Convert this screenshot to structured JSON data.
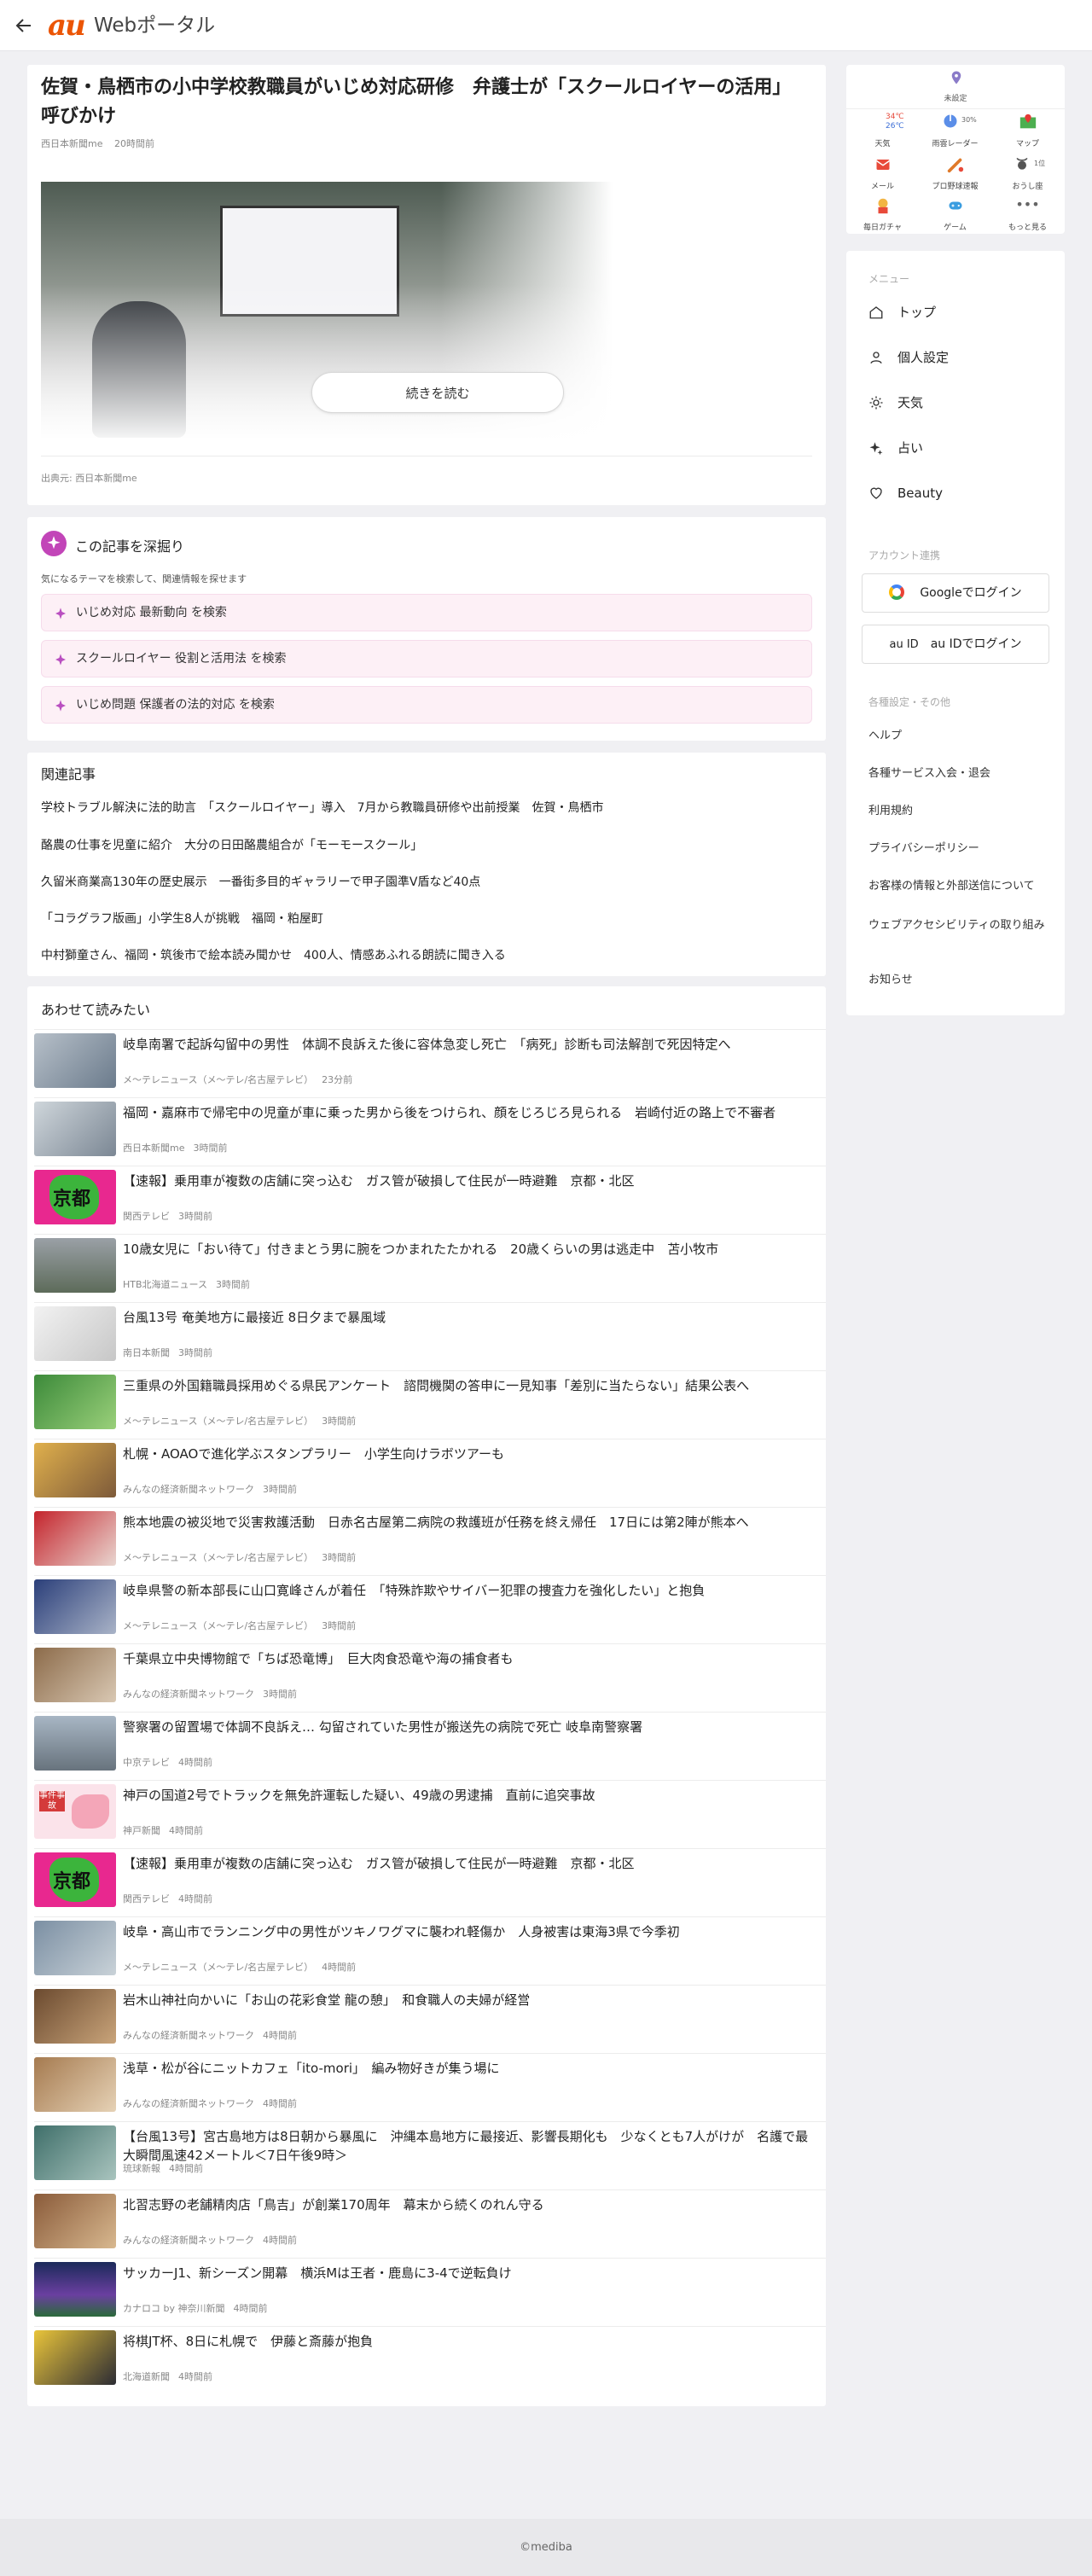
{
  "header": {
    "logo": "au",
    "brand": "Webポータル",
    "icons": {
      "back": "back-arrow-icon"
    }
  },
  "article": {
    "title": "佐賀・鳥栖市の小中学校教職員がいじめ対応研修　弁護士が「スクールロイヤーの活用」呼びかけ",
    "source": "西日本新聞me",
    "time": "20時間前",
    "continue_label": "続きを読む",
    "credit": "出典元: 西日本新聞me"
  },
  "deep_dive": {
    "title": "この記事を深掘り",
    "hint": "気になるテーマを検索して、関連情報を探せます",
    "queries": [
      "いじめ対応 最新動向 を検索",
      "スクールロイヤー 役割と活用法 を検索",
      "いじめ問題 保護者の法的対応 を検索"
    ]
  },
  "related": {
    "title": "関連記事",
    "items": [
      "学校トラブル解決に法的助言　「スクールロイヤー」導入　7月から教職員研修や出前授業　佐賀・鳥栖市",
      "酪農の仕事を児童に紹介　大分の日田酪農組合が「モーモースクール」",
      "久留米商業高130年の歴史展示　一番街多目的ギャラリーで甲子園準V盾など40点",
      "「コラグラフ版画」小学生8人が挑戦　福岡・粕屋町",
      "中村獅童さん、福岡・筑後市で絵本読み聞かせ　400人、情感あふれる朗読に聞き入る"
    ]
  },
  "also_read": {
    "title": "あわせて読みたい",
    "items": [
      {
        "title": "岐阜南署で起訴勾留中の男性　体調不良訴えた後に容体急変し死亡　「病死」診断も司法解剖で死因特定へ",
        "source": "メ～テレニュース（メ～テレ/名古屋テレビ）",
        "time": "23分前"
      },
      {
        "title": "福岡・嘉麻市で帰宅中の児童が車に乗った男から後をつけられ、顔をじろじろ見られる　岩崎付近の路上で不審者",
        "source": "西日本新聞me",
        "time": "3時間前"
      },
      {
        "title": "【速報】乗用車が複数の店舗に突っ込む　ガス管が破損して住民が一時避難　京都・北区",
        "source": "関西テレビ",
        "time": "3時間前",
        "badge": "京都"
      },
      {
        "title": "10歳女児に「おい待て」付きまとう男に腕をつかまれたたかれる　20歳くらいの男は逃走中　苫小牧市",
        "source": "HTB北海道ニュース",
        "time": "3時間前"
      },
      {
        "title": "台風13号 奄美地方に最接近 8日夕まで暴風域",
        "source": "南日本新聞",
        "time": "3時間前"
      },
      {
        "title": "三重県の外国籍職員採用めぐる県民アンケート　諮問機関の答申に一見知事「差別に当たらない」結果公表へ",
        "source": "メ～テレニュース（メ～テレ/名古屋テレビ）",
        "time": "3時間前"
      },
      {
        "title": "札幌・AOAOで進化学ぶスタンプラリー　小学生向けラボツアーも",
        "source": "みんなの経済新聞ネットワーク",
        "time": "3時間前"
      },
      {
        "title": "熊本地震の被災地で災害救護活動　日赤名古屋第二病院の救護班が任務を終え帰任　17日には第2陣が熊本へ",
        "source": "メ～テレニュース（メ～テレ/名古屋テレビ）",
        "time": "3時間前"
      },
      {
        "title": "岐阜県警の新本部長に山口寛峰さんが着任　「特殊詐欺やサイバー犯罪の捜査力を強化したい」と抱負",
        "source": "メ～テレニュース（メ～テレ/名古屋テレビ）",
        "time": "3時間前"
      },
      {
        "title": "千葉県立中央博物館で「ちば恐竜博」　巨大肉食恐竜や海の捕食者も",
        "source": "みんなの経済新聞ネットワーク",
        "time": "3時間前"
      },
      {
        "title": "警察署の留置場で体調不良訴え… 勾留されていた男性が搬送先の病院で死亡 岐阜南警察署",
        "source": "中京テレビ",
        "time": "4時間前"
      },
      {
        "title": "神戸の国道2号でトラックを無免許運転した疑い、49歳の男逮捕　直前に追突事故",
        "source": "神戸新聞",
        "time": "4時間前",
        "badge": "事件事故"
      },
      {
        "title": "【速報】乗用車が複数の店舗に突っ込む　ガス管が破損して住民が一時避難　京都・北区",
        "source": "関西テレビ",
        "time": "4時間前",
        "badge": "京都"
      },
      {
        "title": "岐阜・高山市でランニング中の男性がツキノワグマに襲われ軽傷か　人身被害は東海3県で今季初",
        "source": "メ～テレニュース（メ～テレ/名古屋テレビ）",
        "time": "4時間前"
      },
      {
        "title": "岩木山神社向かいに「お山の花彩食堂 龍の憩」　和食職人の夫婦が経営",
        "source": "みんなの経済新聞ネットワーク",
        "time": "4時間前"
      },
      {
        "title": "浅草・松が谷にニットカフェ「ito-mori」　編み物好きが集う場に",
        "source": "みんなの経済新聞ネットワーク",
        "time": "4時間前"
      },
      {
        "title": "【台風13号】宮古島地方は8日朝から暴風に　沖縄本島地方に最接近、影響長期化も　少なくとも7人がけが　名護で最大瞬間風速42メートル＜7日午後9時＞",
        "source": "琉球新報",
        "time": "4時間前"
      },
      {
        "title": "北習志野の老舗精肉店「鳥吉」が創業170周年　幕末から続くのれん守る",
        "source": "みんなの経済新聞ネットワーク",
        "time": "4時間前"
      },
      {
        "title": "サッカーJ1、新シーズン開幕　横浜Mは王者・鹿島に3-4で逆転負け",
        "source": "カナロコ by 神奈川新聞",
        "time": "4時間前"
      },
      {
        "title": "将棋JT杯、8日に札幌で　伊藤と斎藤が抱負",
        "source": "北海道新聞",
        "time": "4時間前"
      }
    ]
  },
  "utilities": {
    "location": "未設定",
    "weather_high": "34℃",
    "weather_low": "26℃",
    "rain_pct": "30%",
    "fortune_rank": "1位",
    "cells": [
      "天気",
      "雨雲レーダー",
      "マップ",
      "メール",
      "プロ野球速報",
      "おうし座",
      "毎日ガチャ",
      "ゲーム",
      "もっと見る"
    ]
  },
  "menu": {
    "heading": "メニュー",
    "items": [
      "トップ",
      "個人設定",
      "天気",
      "占い",
      "Beauty"
    ],
    "account_heading": "アカウント連携",
    "google_login": "Googleでログイン",
    "au_login": "au IDでログイン",
    "au_alt": "au ID",
    "settings_heading": "各種設定・その他",
    "links": [
      "ヘルプ",
      "各種サービス入会・退会",
      "利用規約",
      "プライバシーポリシー",
      "お客様の情報と外部送信について",
      "ウェブアクセシビリティの取り組み",
      "お知らせ"
    ]
  },
  "footer": {
    "copyright": "©mediba"
  }
}
